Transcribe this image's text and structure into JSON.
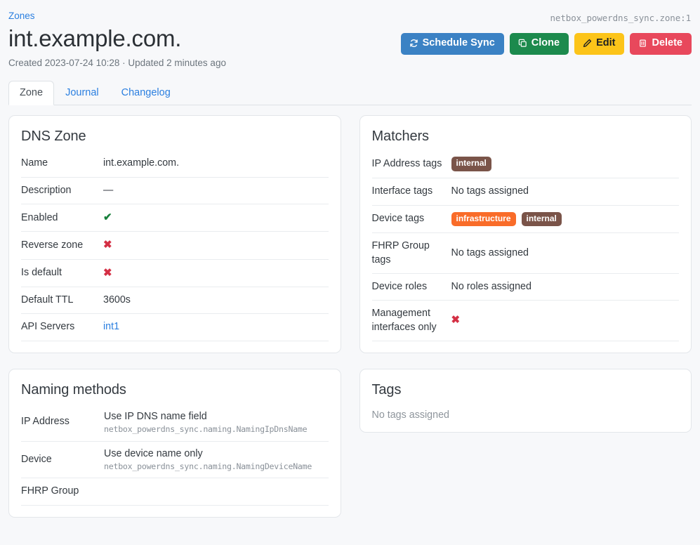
{
  "header": {
    "breadcrumb": "Zones",
    "title": "int.example.com.",
    "object_id": "netbox_powerdns_sync.zone:1",
    "subtitle": "Created 2023-07-24 10:28 · Updated 2 minutes ago"
  },
  "actions": [
    {
      "label": "Schedule Sync",
      "icon": "sync-icon",
      "color": "#3b82c4"
    },
    {
      "label": "Clone",
      "icon": "copy-icon",
      "color": "#1c8a4d"
    },
    {
      "label": "Edit",
      "icon": "pencil-icon",
      "color": "#fcc419"
    },
    {
      "label": "Delete",
      "icon": "trash-icon",
      "color": "#e8485c"
    }
  ],
  "tabs": [
    {
      "label": "Zone",
      "active": true
    },
    {
      "label": "Journal",
      "active": false
    },
    {
      "label": "Changelog",
      "active": false
    }
  ],
  "dns_zone": {
    "title": "DNS Zone",
    "rows": [
      {
        "label": "Name",
        "value": "int.example.com.",
        "type": "text"
      },
      {
        "label": "Description",
        "value": "—",
        "type": "mdash"
      },
      {
        "label": "Enabled",
        "value": "✔",
        "type": "check"
      },
      {
        "label": "Reverse zone",
        "value": "✖",
        "type": "cross"
      },
      {
        "label": "Is default",
        "value": "✖",
        "type": "cross"
      },
      {
        "label": "Default TTL",
        "value": "3600s",
        "type": "text"
      },
      {
        "label": "API Servers",
        "value": "int1",
        "type": "link"
      }
    ]
  },
  "matchers": {
    "title": "Matchers",
    "rows": [
      {
        "label": "IP Address tags",
        "type": "tags",
        "tags": [
          {
            "label": "internal",
            "color": "#7a5449"
          }
        ]
      },
      {
        "label": "Interface tags",
        "type": "muted",
        "value": "No tags assigned"
      },
      {
        "label": "Device tags",
        "type": "tags",
        "tags": [
          {
            "label": "infrastructure",
            "color": "#f96c29"
          },
          {
            "label": "internal",
            "color": "#7a5449"
          }
        ]
      },
      {
        "label": "FHRP Group tags",
        "type": "muted",
        "value": "No tags assigned"
      },
      {
        "label": "Device roles",
        "type": "muted",
        "value": "No roles assigned"
      },
      {
        "label": "Management interfaces only",
        "type": "cross",
        "value": "✖"
      }
    ]
  },
  "naming_methods": {
    "title": "Naming methods",
    "rows": [
      {
        "label": "IP Address",
        "value": "Use IP DNS name field",
        "class_path": "netbox_powerdns_sync.naming.NamingIpDnsName"
      },
      {
        "label": "Device",
        "value": "Use device name only",
        "class_path": "netbox_powerdns_sync.naming.NamingDeviceName"
      },
      {
        "label": "FHRP Group",
        "value": "",
        "class_path": ""
      }
    ]
  },
  "tags_card": {
    "title": "Tags",
    "empty_text": "No tags assigned"
  }
}
